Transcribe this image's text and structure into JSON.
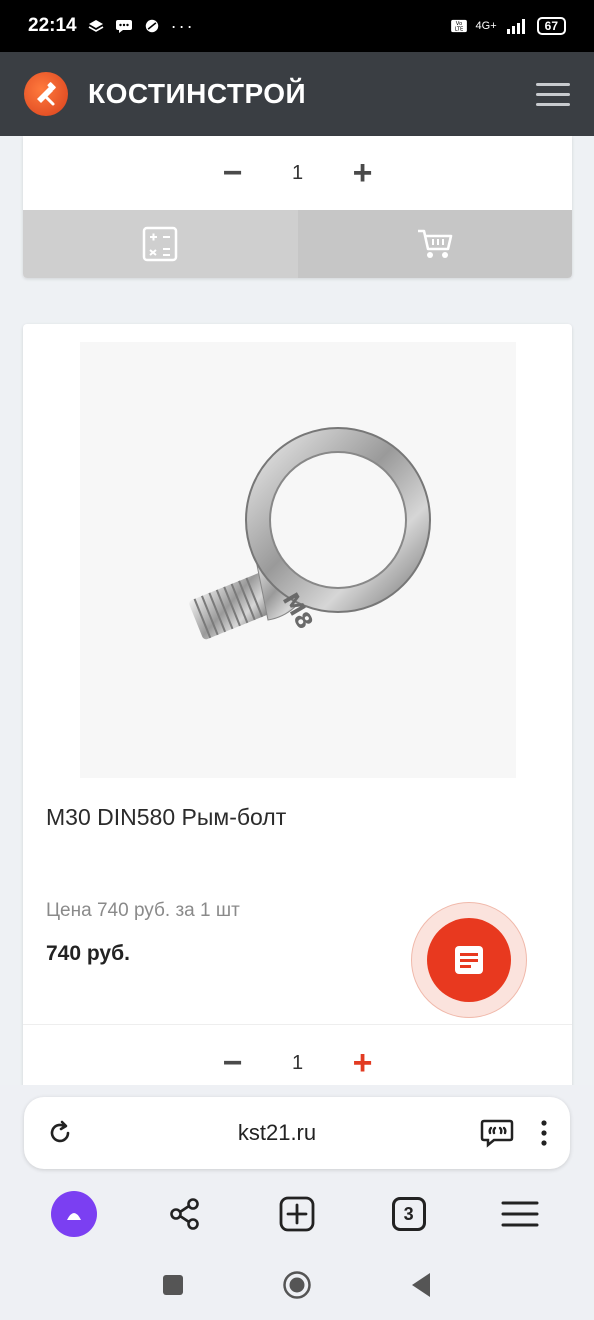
{
  "status_bar": {
    "time": "22:14",
    "network": "4G+",
    "battery": "67"
  },
  "site": {
    "title": "КОСТИНСТРОЙ"
  },
  "top_card": {
    "quantity": "1",
    "minus": "−",
    "plus": "+"
  },
  "product": {
    "name": "M30 DIN580 Рым-болт",
    "price_note": "Цена 740 руб. за 1 шт",
    "price": "740 руб.",
    "quantity": "1",
    "minus": "−",
    "plus": "+",
    "image_marking": "M8"
  },
  "browser": {
    "url": "kst21.ru",
    "tabs_count": "3"
  },
  "colors": {
    "header": "#3a3e43",
    "accent": "#e8391f",
    "alice": "#7b3ff2"
  }
}
